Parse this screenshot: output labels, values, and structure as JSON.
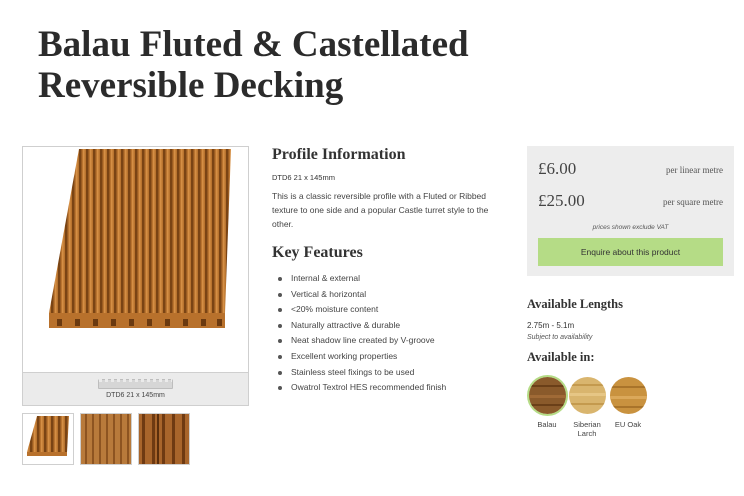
{
  "product": {
    "title_line1": "Balau Fluted & Castellated",
    "title_line2": "Reversible Decking"
  },
  "image": {
    "profile_caption": "DTD6 21 x 145mm"
  },
  "profile": {
    "heading": "Profile Information",
    "code": "DTD6 21 x 145mm",
    "description": "This is a classic reversible profile with a Fluted or Ribbed texture to one side and a popular Castle turret style to the other."
  },
  "features": {
    "heading": "Key Features",
    "items": [
      "Internal & external",
      "Vertical & horizontal",
      "<20% moisture content",
      "Naturally attractive & durable",
      "Neat shadow line created by V-groove",
      "Excellent working properties",
      "Stainless steel fixings to be used",
      "Owatrol Textrol HES recommended finish"
    ]
  },
  "pricing": {
    "linear_price": "£6.00",
    "linear_unit": "per linear metre",
    "square_price": "£25.00",
    "square_unit": "per square metre",
    "vat_note": "prices shown exclude VAT",
    "enquire_label": "Enquire about this product",
    "button_color": "#b5dc86",
    "box_color": "#ededed"
  },
  "lengths": {
    "heading": "Available Lengths",
    "value": "2.75m - 5.1m",
    "note": "Subject to availability"
  },
  "availability": {
    "heading": "Available in:",
    "options": [
      {
        "label": "Balau",
        "selected": true,
        "color": "#8a5a2b"
      },
      {
        "label": "Siberian Larch",
        "selected": false,
        "color": "#d9b56e"
      },
      {
        "label": "EU Oak",
        "selected": false,
        "color": "#c9923f"
      }
    ]
  }
}
